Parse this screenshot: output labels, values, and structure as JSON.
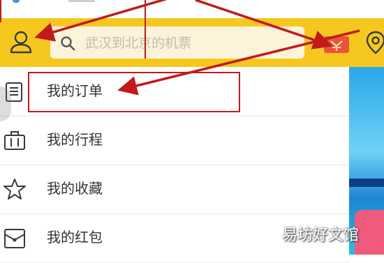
{
  "search": {
    "placeholder": "武汉到北京的机票"
  },
  "menu": {
    "items": [
      {
        "label": "我的订单",
        "icon": "order-list-icon"
      },
      {
        "label": "我的行程",
        "icon": "suitcase-icon"
      },
      {
        "label": "我的收藏",
        "icon": "star-icon"
      },
      {
        "label": "我的红包",
        "icon": "red-envelope-icon"
      }
    ]
  },
  "watermark": "易坊好文馆",
  "colors": {
    "topbar": "#f6c81f",
    "annotation": "#c21a1a",
    "search_bg": "#fbf3da"
  }
}
